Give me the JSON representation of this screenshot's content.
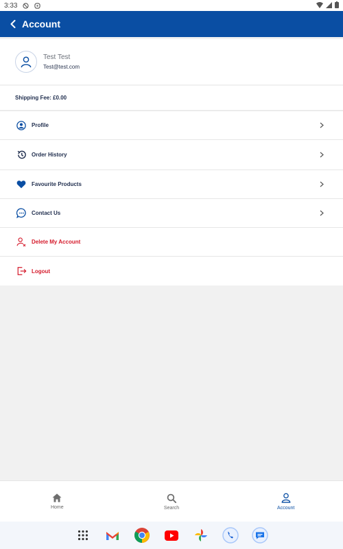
{
  "status_bar": {
    "time": "3:33"
  },
  "header": {
    "title": "Account"
  },
  "user": {
    "name": "Test Test",
    "email": "Test@test.com"
  },
  "shipping": {
    "text": "Shipping Fee: £0.00"
  },
  "menu": {
    "items": [
      {
        "label": "Profile",
        "icon": "profile-icon"
      },
      {
        "label": "Order History",
        "icon": "history-icon"
      },
      {
        "label": "Favourite Products",
        "icon": "heart-icon"
      },
      {
        "label": "Contact Us",
        "icon": "chat-icon"
      },
      {
        "label": "Delete My Account",
        "icon": "delete-user-icon"
      },
      {
        "label": "Logout",
        "icon": "logout-icon"
      }
    ]
  },
  "bottom_nav": {
    "items": [
      {
        "label": "Home",
        "icon": "home-icon"
      },
      {
        "label": "Search",
        "icon": "search-icon"
      },
      {
        "label": "Account",
        "icon": "account-icon",
        "active": true
      }
    ]
  },
  "colors": {
    "primary": "#0a4ea3",
    "danger": "#d51b2c",
    "background": "#f1f1f1"
  }
}
